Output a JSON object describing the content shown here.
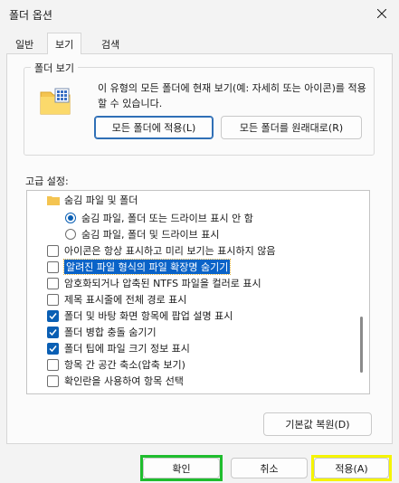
{
  "window": {
    "title": "폴더 옵션"
  },
  "tabs": [
    {
      "label": "일반"
    },
    {
      "label": "보기"
    },
    {
      "label": "검색"
    }
  ],
  "folder_views": {
    "label": "폴더 보기",
    "description": "이 유형의 모든 폴더에 현재 보기(예: 자세히 또는 아이콘)를 적용할 수 있습니다.",
    "apply_button": "모든 폴더에 적용(L)",
    "reset_button": "모든 폴더를 원래대로(R)"
  },
  "advanced": {
    "label": "고급 설정:",
    "items": [
      {
        "type": "folder",
        "label": "숨김 파일 및 폴더",
        "indent": 1
      },
      {
        "type": "radio",
        "label": "숨김 파일, 폴더 또는 드라이브 표시 안 함",
        "checked": true,
        "indent": 2
      },
      {
        "type": "radio",
        "label": "숨김 파일, 폴더 및 드라이브 표시",
        "checked": false,
        "indent": 2
      },
      {
        "type": "checkbox",
        "label": "아이콘은 항상 표시하고 미리 보기는 표시하지 않음",
        "checked": false,
        "indent": 0
      },
      {
        "type": "checkbox",
        "label": "알려진 파일 형식의 파일 확장명 숨기기",
        "checked": false,
        "indent": 0,
        "selected": true
      },
      {
        "type": "checkbox",
        "label": "암호화되거나 압축된 NTFS 파일을 컬러로 표시",
        "checked": false,
        "indent": 0
      },
      {
        "type": "checkbox",
        "label": "제목 표시줄에 전체 경로 표시",
        "checked": false,
        "indent": 0
      },
      {
        "type": "checkbox",
        "label": "폴더 및 바탕 화면 항목에 팝업 설명 표시",
        "checked": true,
        "indent": 0
      },
      {
        "type": "checkbox",
        "label": "폴더 병합 충돌 숨기기",
        "checked": true,
        "indent": 0
      },
      {
        "type": "checkbox",
        "label": "폴더 팁에 파일 크기 정보 표시",
        "checked": true,
        "indent": 0
      },
      {
        "type": "checkbox",
        "label": "항목 간 공간 축소(압축 보기)",
        "checked": false,
        "indent": 0
      },
      {
        "type": "checkbox",
        "label": "확인란을 사용하여 항목 선택",
        "checked": false,
        "indent": 0
      }
    ],
    "restore_button": "기본값 복원(D)"
  },
  "footer": {
    "ok": "확인",
    "cancel": "취소",
    "apply": "적용(A)"
  },
  "colors": {
    "accent": "#0a5fb4",
    "highlight_green": "#1fbd2e",
    "highlight_yellow": "#f5f400"
  }
}
